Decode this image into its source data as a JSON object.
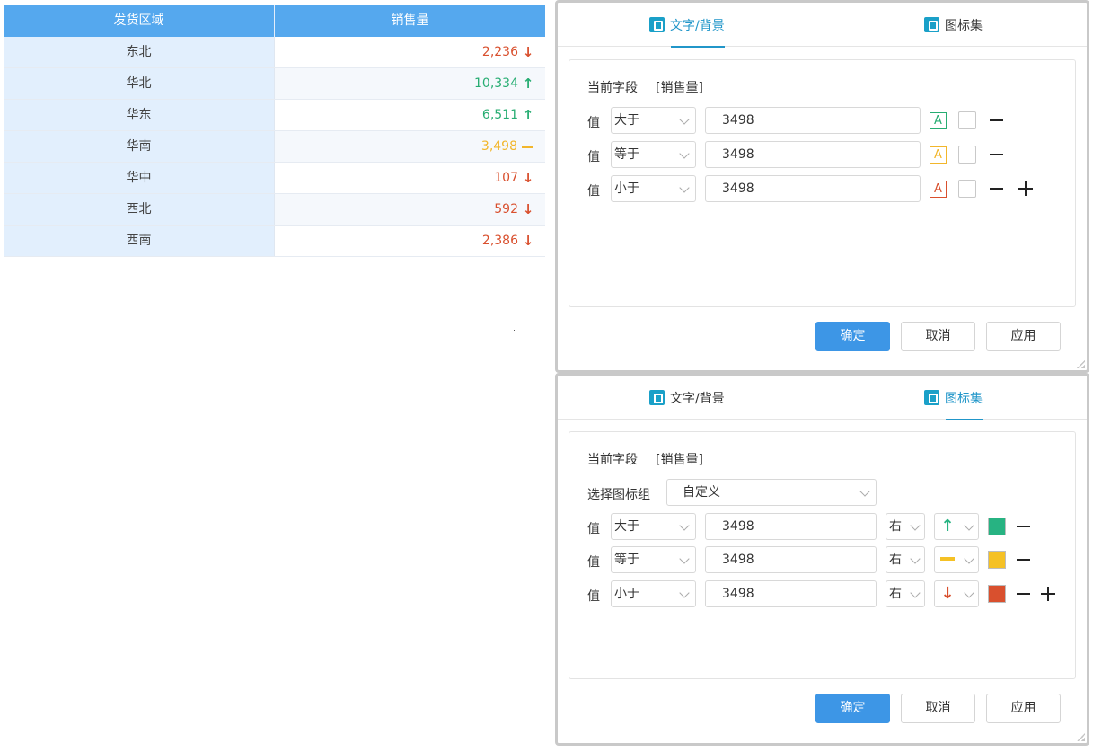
{
  "table": {
    "headers": [
      "发货区域",
      "销售量"
    ],
    "rows": [
      {
        "region": "东北",
        "value": "2,236",
        "trend": "down"
      },
      {
        "region": "华北",
        "value": "10,334",
        "trend": "up"
      },
      {
        "region": "华东",
        "value": "6,511",
        "trend": "up"
      },
      {
        "region": "华南",
        "value": "3,498",
        "trend": "equal"
      },
      {
        "region": "华中",
        "value": "107",
        "trend": "down"
      },
      {
        "region": "西北",
        "value": "592",
        "trend": "down"
      },
      {
        "region": "西南",
        "value": "2,386",
        "trend": "down"
      }
    ]
  },
  "colors": {
    "up": "#27ad72",
    "equal": "#f2b62b",
    "down": "#d9502e",
    "primary": "#3d96e6",
    "accent": "#2196c9"
  },
  "dialog1": {
    "tabs": [
      "文字/背景",
      "图标集"
    ],
    "active_tab": "文字/背景",
    "field_label": "当前字段",
    "field_value": "[销售量]",
    "rules": [
      {
        "prefix": "值",
        "op": "大于",
        "value": "3498",
        "font_letter": "A",
        "font_color": "#27ad72"
      },
      {
        "prefix": "值",
        "op": "等于",
        "value": "3498",
        "font_letter": "A",
        "font_color": "#f2b62b"
      },
      {
        "prefix": "值",
        "op": "小于",
        "value": "3498",
        "font_letter": "A",
        "font_color": "#d9502e"
      }
    ],
    "buttons": {
      "ok": "确定",
      "cancel": "取消",
      "apply": "应用"
    }
  },
  "dialog2": {
    "tabs": [
      "文字/背景",
      "图标集"
    ],
    "active_tab": "图标集",
    "field_label": "当前字段",
    "field_value": "[销售量]",
    "icon_group_label": "选择图标组",
    "icon_group_value": "自定义",
    "rules": [
      {
        "prefix": "值",
        "op": "大于",
        "value": "3498",
        "position": "右",
        "icon": "arrow-up-icon",
        "color": "#27b382"
      },
      {
        "prefix": "值",
        "op": "等于",
        "value": "3498",
        "position": "右",
        "icon": "dash-icon",
        "color": "#f5c125"
      },
      {
        "prefix": "值",
        "op": "小于",
        "value": "3498",
        "position": "右",
        "icon": "arrow-down-icon",
        "color": "#d9502e"
      }
    ],
    "buttons": {
      "ok": "确定",
      "cancel": "取消",
      "apply": "应用"
    }
  }
}
